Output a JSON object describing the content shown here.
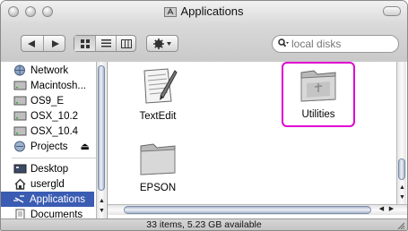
{
  "window": {
    "title": "Applications"
  },
  "toolbar": {
    "back_icon": "back-arrow-icon",
    "forward_icon": "forward-arrow-icon",
    "view_icons": [
      "icon-view-icon",
      "list-view-icon",
      "column-view-icon"
    ],
    "action_icon": "gear-icon",
    "search_placeholder": "local disks"
  },
  "sidebar": {
    "devices": [
      {
        "label": "Network",
        "icon": "network-globe-icon"
      },
      {
        "label": "Macintosh...",
        "icon": "hard-disk-icon"
      },
      {
        "label": "OS9_E",
        "icon": "hard-disk-icon"
      },
      {
        "label": "OSX_10.2",
        "icon": "hard-disk-icon"
      },
      {
        "label": "OSX_10.4",
        "icon": "hard-disk-icon"
      },
      {
        "label": "Projects",
        "icon": "network-volume-icon",
        "eject": "⏏"
      }
    ],
    "places": [
      {
        "label": "Desktop",
        "icon": "desktop-icon"
      },
      {
        "label": "usergld",
        "icon": "home-icon"
      },
      {
        "label": "Applications",
        "icon": "applications-icon",
        "selected": true
      },
      {
        "label": "Documents",
        "icon": "documents-icon"
      }
    ]
  },
  "files": [
    {
      "label": "TextEdit",
      "icon": "textedit-app-icon"
    },
    {
      "label": "Utilities",
      "icon": "folder-icon",
      "highlighted": true
    },
    {
      "label": "EPSON",
      "icon": "folder-icon"
    }
  ],
  "status": {
    "text": "33 items, 5.23 GB available"
  },
  "colors": {
    "selection": "#3b5cb3",
    "highlight_outline": "#e000d0"
  }
}
